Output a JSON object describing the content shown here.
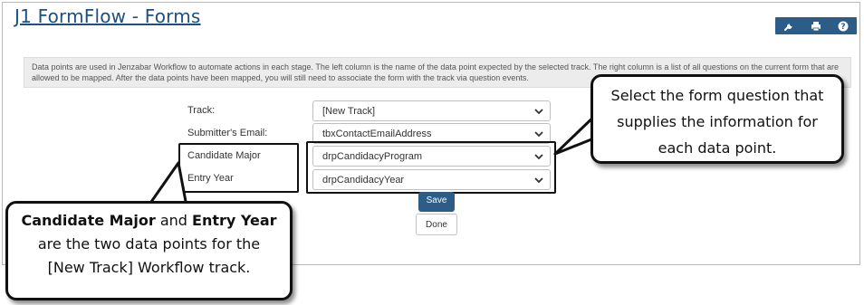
{
  "page": {
    "title": "J1 FormFlow - Forms"
  },
  "toolbar": {
    "icons": [
      "wrench-icon",
      "printer-icon",
      "help-icon"
    ],
    "help_glyph": "?"
  },
  "info": {
    "text": "Data points are used in Jenzabar Workflow to automate actions in each stage. The left column is the name of the data point expected by the selected track. The right column is a list of all questions on the current form that are allowed to be mapped. After the data points have been mapped, you will still need to associate the form with the track via question events."
  },
  "form": {
    "rows": [
      {
        "label": "Track:",
        "value": "[New Track]"
      },
      {
        "label": "Submitter's Email:",
        "value": "tbxContactEmailAddress"
      },
      {
        "label": "Candidate Major",
        "value": "drpCandidacyProgram"
      },
      {
        "label": "Entry Year",
        "value": "drpCandidacyYear"
      }
    ],
    "save_label": "Save",
    "done_label": "Done"
  },
  "callouts": {
    "right": {
      "line1": "Select the form question that",
      "line2": "supplies the information for",
      "line3": "each data point."
    },
    "left": {
      "bold1": "Candidate Major",
      "and": " and ",
      "bold2": "Entry Year",
      "line2": "are the two data points for the",
      "line3": "[New Track] Workflow track."
    }
  },
  "colors": {
    "title": "#1f4f7e",
    "toolbar": "#2c5c88",
    "save_button": "#2c5c88",
    "info_background": "#ececec"
  }
}
